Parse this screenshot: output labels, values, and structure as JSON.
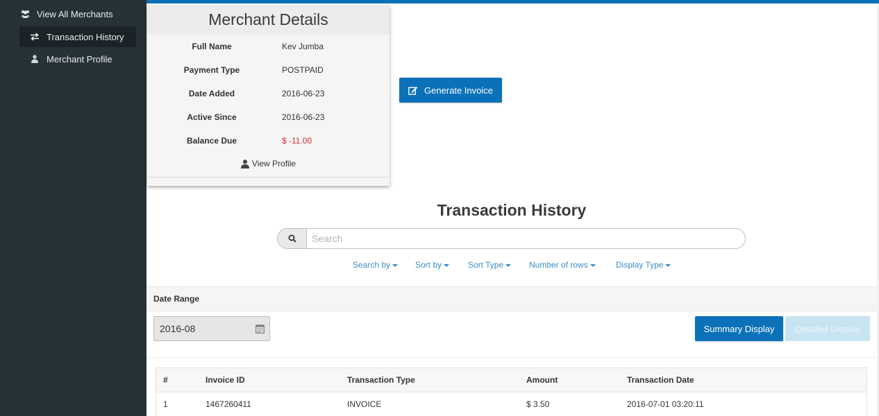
{
  "sidebar": {
    "items": [
      {
        "label": "View All Merchants",
        "icon": "users-icon"
      },
      {
        "label": "Transaction History",
        "icon": "exchange-icon"
      },
      {
        "label": "Merchant Profile",
        "icon": "user-icon"
      }
    ]
  },
  "merchant": {
    "title": "Merchant Details",
    "fields": [
      {
        "label": "Full Name",
        "value": "Kev Jumba"
      },
      {
        "label": "Payment Type",
        "value": "POSTPAID"
      },
      {
        "label": "Date Added",
        "value": "2016-06-23"
      },
      {
        "label": "Active Since",
        "value": "2016-06-23"
      },
      {
        "label": "Balance Due",
        "value": "$ -11.00"
      }
    ],
    "view_profile_label": "View Profile"
  },
  "actions": {
    "generate_invoice_label": "Generate Invoice"
  },
  "history": {
    "title": "Transaction History",
    "search": {
      "placeholder": "Search",
      "value": ""
    },
    "filters": [
      "Search by",
      "Sort by",
      "Sort Type",
      "Number of rows",
      "Display Type"
    ],
    "date_range_label": "Date Range",
    "date_value": "2016-08",
    "summary_label": "Summary Display",
    "detailed_label": "Detailed Display"
  },
  "table": {
    "headers": [
      "#",
      "Invoice ID",
      "Transaction Type",
      "Amount",
      "Transaction Date"
    ],
    "rows": [
      [
        "1",
        "1467260411",
        "INVOICE",
        "$ 3.50",
        "2016-07-01 03:20:11"
      ]
    ]
  },
  "colors": {
    "accent": "#0b72b9",
    "sidebar": "#263238",
    "negative": "#d9312c",
    "link": "#3a8ec8"
  }
}
